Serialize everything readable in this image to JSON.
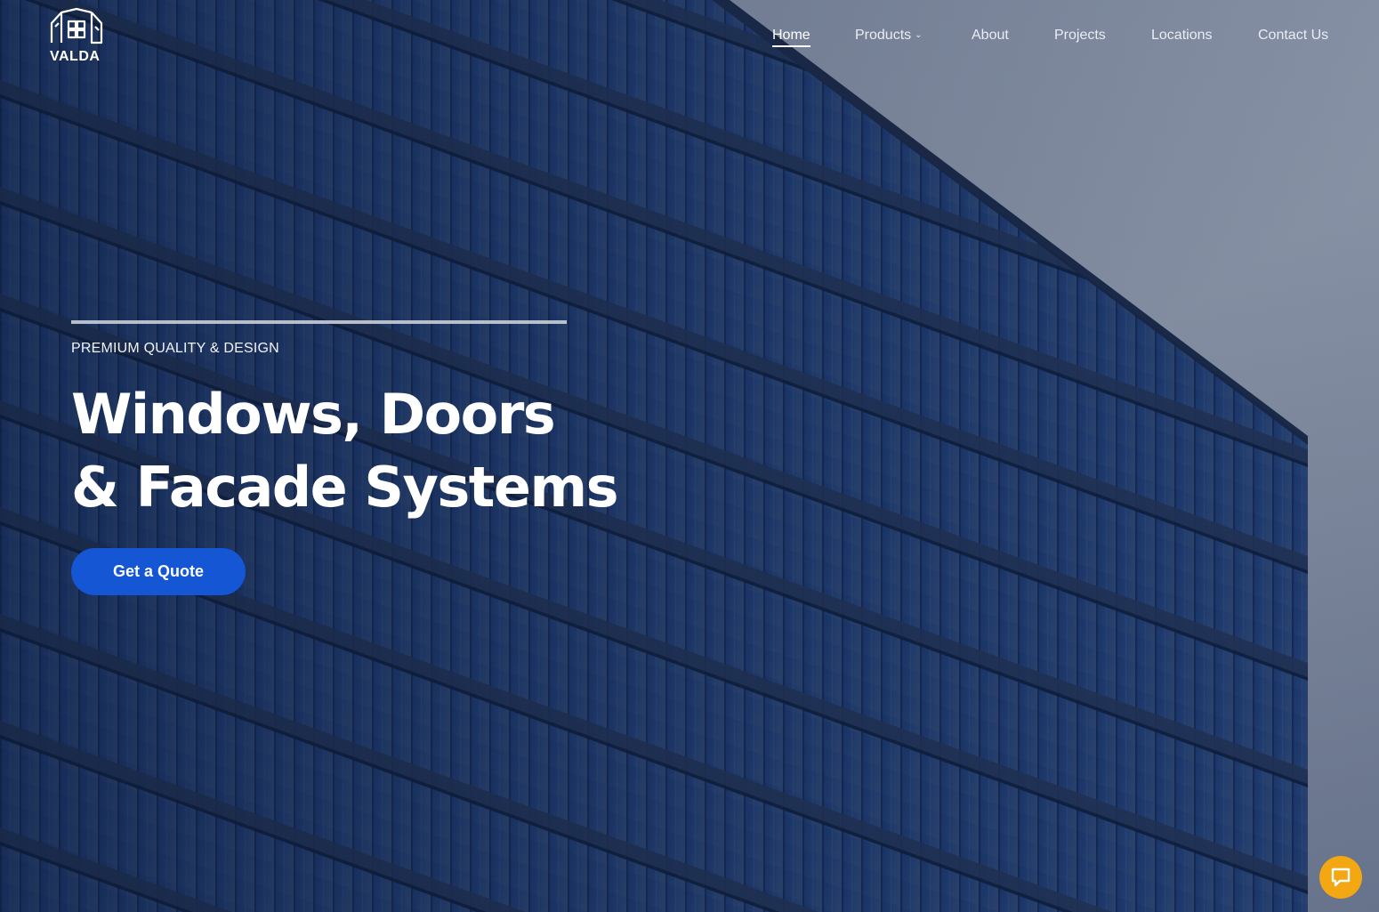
{
  "brand": {
    "name": "VALDA"
  },
  "nav": {
    "items": [
      {
        "label": "Home",
        "active": true
      },
      {
        "label": "Products",
        "has_dropdown": true
      },
      {
        "label": "About"
      },
      {
        "label": "Projects"
      },
      {
        "label": "Locations"
      },
      {
        "label": "Contact Us"
      }
    ]
  },
  "hero": {
    "eyebrow": "PREMIUM QUALITY & DESIGN",
    "title_line1": "Windows, Doors",
    "title_line2": "& Facade Systems",
    "cta_label": "Get a Quote",
    "background": "glass-facade-building-photo"
  },
  "chat": {
    "icon": "chat-bubble-icon"
  },
  "colors": {
    "accent": "#1456d4",
    "chat": "#f3a712",
    "text": "#ffffff"
  }
}
